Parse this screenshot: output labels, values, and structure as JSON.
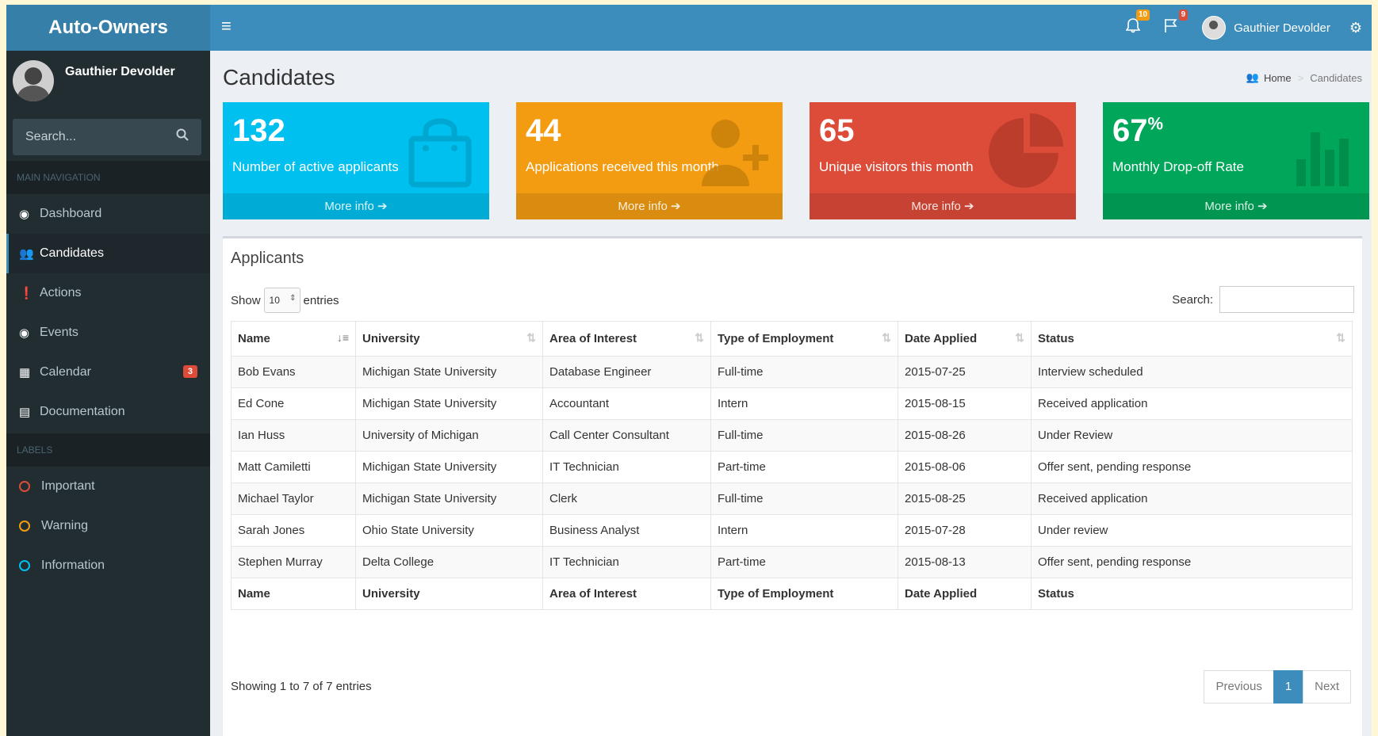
{
  "brand": "Auto-Owners",
  "topbar": {
    "menu_icon": "hamburger-icon",
    "notifications_count": "10",
    "flags_count": "9",
    "user_name": "Gauthier Devolder"
  },
  "sidebar": {
    "user_name": "Gauthier Devolder",
    "search_placeholder": "Search...",
    "nav_header": "MAIN NAVIGATION",
    "labels_header": "LABELS",
    "items": [
      {
        "label": "Dashboard",
        "icon": "dashboard-icon"
      },
      {
        "label": "Candidates",
        "icon": "users-icon"
      },
      {
        "label": "Actions",
        "icon": "exclamation-circle-icon"
      },
      {
        "label": "Events",
        "icon": "dashboard-icon"
      },
      {
        "label": "Calendar",
        "icon": "calendar-icon",
        "badge": "3"
      },
      {
        "label": "Documentation",
        "icon": "book-icon"
      }
    ],
    "labels": [
      {
        "label": "Important",
        "color": "#dd4b39"
      },
      {
        "label": "Warning",
        "color": "#f39c12"
      },
      {
        "label": "Information",
        "color": "#00c0ef"
      }
    ]
  },
  "page": {
    "title": "Candidates",
    "breadcrumb": [
      "Home",
      "Candidates"
    ]
  },
  "stats": [
    {
      "value": "132",
      "suffix": "",
      "label": "Number of active applicants",
      "footer": "More info ➔",
      "color": "#00c0ef",
      "icon": "shopping-bag-icon"
    },
    {
      "value": "44",
      "suffix": "",
      "label": "Applications received this month",
      "footer": "More info ➔",
      "color": "#f39c12",
      "icon": "user-plus-icon"
    },
    {
      "value": "65",
      "suffix": "",
      "label": "Unique visitors this month",
      "footer": "More info ➔",
      "color": "#dd4b39",
      "icon": "pie-chart-icon"
    },
    {
      "value": "67",
      "suffix": "%",
      "label": "Monthly Drop-off Rate",
      "footer": "More info ➔",
      "color": "#00a65a",
      "icon": "bar-chart-icon"
    }
  ],
  "applicants": {
    "title": "Applicants",
    "show_label": "Show",
    "show_value": "10",
    "entries_label": "entries",
    "search_label": "Search:",
    "columns": [
      "Name",
      "University",
      "Area of Interest",
      "Type of Employment",
      "Date Applied",
      "Status"
    ],
    "rows": [
      [
        "Bob Evans",
        "Michigan State University",
        "Database Engineer",
        "Full-time",
        "2015-07-25",
        "Interview scheduled"
      ],
      [
        "Ed Cone",
        "Michigan State University",
        "Accountant",
        "Intern",
        "2015-08-15",
        "Received application"
      ],
      [
        "Ian Huss",
        "University of Michigan",
        "Call Center Consultant",
        "Full-time",
        "2015-08-26",
        "Under Review"
      ],
      [
        "Matt Camiletti",
        "Michigan State University",
        "IT Technician",
        "Part-time",
        "2015-08-06",
        "Offer sent, pending response"
      ],
      [
        "Michael Taylor",
        "Michigan State University",
        "Clerk",
        "Full-time",
        "2015-08-25",
        "Received application"
      ],
      [
        "Sarah Jones",
        "Ohio State University",
        "Business Analyst",
        "Intern",
        "2015-07-28",
        "Under review"
      ],
      [
        "Stephen Murray",
        "Delta College",
        "IT Technician",
        "Part-time",
        "2015-08-13",
        "Offer sent, pending response"
      ]
    ],
    "info": "Showing 1 to 7 of 7 entries",
    "pager": {
      "prev": "Previous",
      "current": "1",
      "next": "Next"
    }
  }
}
